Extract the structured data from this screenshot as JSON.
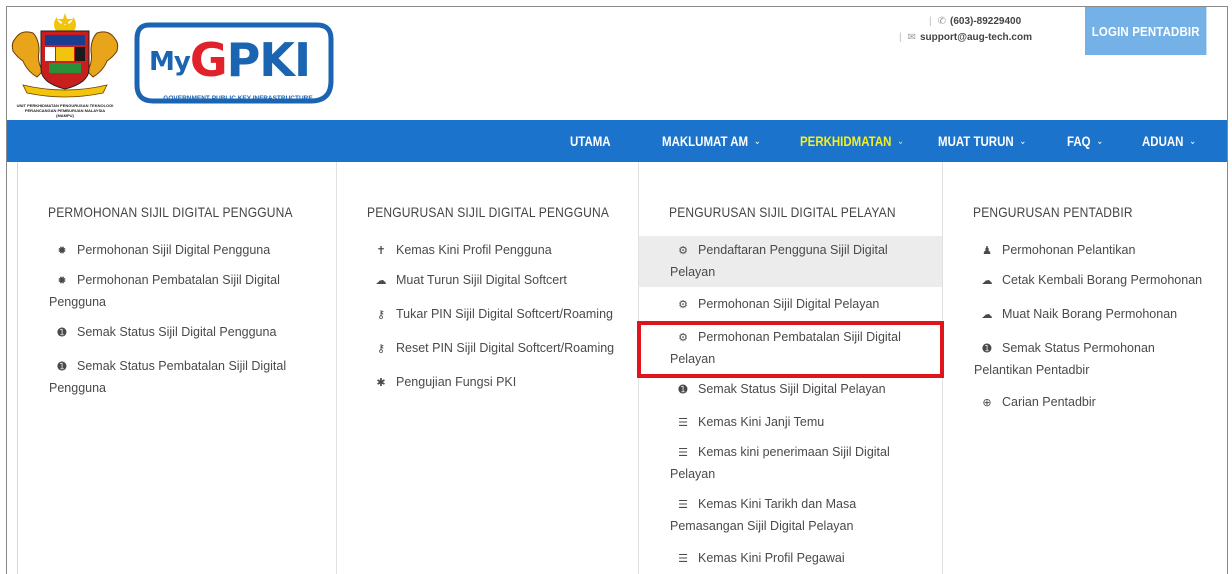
{
  "header": {
    "crest_caption": [
      "UNIT PERKHIDMATAN PENGURUSAN TEKNOLOGI",
      "PERANCANGAN PEMBURUAN MALAYSIA",
      "(MAMPU)"
    ],
    "logo": {
      "prefix": "My",
      "mid": "G",
      "rest": "PKI",
      "tagline": "GOVERNMENT PUBLIC KEY INFRASTRUCTURE"
    },
    "phone": "(603)-89229400",
    "email": "support@aug-tech.com",
    "login_label": "LOGIN PENTADBIR",
    "accent_color": "#1b73cc"
  },
  "nav": {
    "items": [
      {
        "label": "UTAMA",
        "has_dropdown": false,
        "active": false
      },
      {
        "label": "MAKLUMAT AM",
        "has_dropdown": true,
        "active": false
      },
      {
        "label": "PERKHIDMATAN",
        "has_dropdown": true,
        "active": true
      },
      {
        "label": "MUAT TURUN",
        "has_dropdown": true,
        "active": false
      },
      {
        "label": "FAQ",
        "has_dropdown": true,
        "active": false
      },
      {
        "label": "ADUAN",
        "has_dropdown": true,
        "active": false
      }
    ],
    "active_color": "#f5ee20"
  },
  "menu": {
    "columns": [
      {
        "title": "PERMOHONAN SIJIL DIGITAL PENGGUNA",
        "items": [
          {
            "icon": "gear-icon",
            "label": "Permohonan Sijil Digital Pengguna"
          },
          {
            "icon": "gear-icon",
            "label": "Permohonan Pembatalan Sijil Digital Pengguna"
          },
          {
            "icon": "info-icon",
            "label": "Semak Status Sijil Digital Pengguna"
          },
          {
            "icon": "info-icon",
            "label": "Semak Status Pembatalan Sijil Digital Pengguna"
          }
        ]
      },
      {
        "title": "PENGURUSAN SIJIL DIGITAL PENGGUNA",
        "items": [
          {
            "icon": "user-tie-icon",
            "label": "Kemas Kini Profil Pengguna"
          },
          {
            "icon": "cloud-download-icon",
            "label": "Muat Turun Sijil Digital Softcert"
          },
          {
            "icon": "key-icon",
            "label": "Tukar PIN Sijil Digital Softcert/Roaming"
          },
          {
            "icon": "key-icon",
            "label": "Reset PIN Sijil Digital Softcert/Roaming"
          },
          {
            "icon": "asterisk-icon",
            "label": "Pengujian Fungsi PKI"
          }
        ]
      },
      {
        "title": "PENGURUSAN SIJIL DIGITAL PELAYAN",
        "items": [
          {
            "icon": "server-icon",
            "label": "Pendaftaran Pengguna Sijil Digital Pelayan",
            "highlight": true
          },
          {
            "icon": "server-icon",
            "label": "Permohonan Sijil Digital Pelayan"
          },
          {
            "icon": "server-icon",
            "label": "Permohonan Pembatalan Sijil Digital Pelayan",
            "boxed": true
          },
          {
            "icon": "info-icon",
            "label": "Semak Status Sijil Digital Pelayan"
          },
          {
            "icon": "list-icon",
            "label": "Kemas Kini Janji Temu"
          },
          {
            "icon": "list-icon",
            "label": "Kemas kini penerimaan Sijil Digital Pelayan"
          },
          {
            "icon": "list-icon",
            "label": "Kemas Kini Tarikh dan Masa Pemasangan Sijil Digital Pelayan"
          },
          {
            "icon": "list-icon",
            "label": "Kemas Kini Profil Pegawai"
          }
        ]
      },
      {
        "title": "PENGURUSAN PENTADBIR",
        "items": [
          {
            "icon": "user-icon",
            "label": "Permohonan Pelantikan"
          },
          {
            "icon": "cloud-upload-icon",
            "label": "Cetak Kembali Borang Permohonan"
          },
          {
            "icon": "cloud-upload-icon",
            "label": "Muat Naik Borang Permohonan"
          },
          {
            "icon": "info-icon",
            "label": "Semak Status Permohonan Pelantikan Pentadbir"
          },
          {
            "icon": "search-plus-icon",
            "label": "Carian Pentadbir"
          }
        ]
      }
    ],
    "highlight_box_color": "#e0151b"
  }
}
